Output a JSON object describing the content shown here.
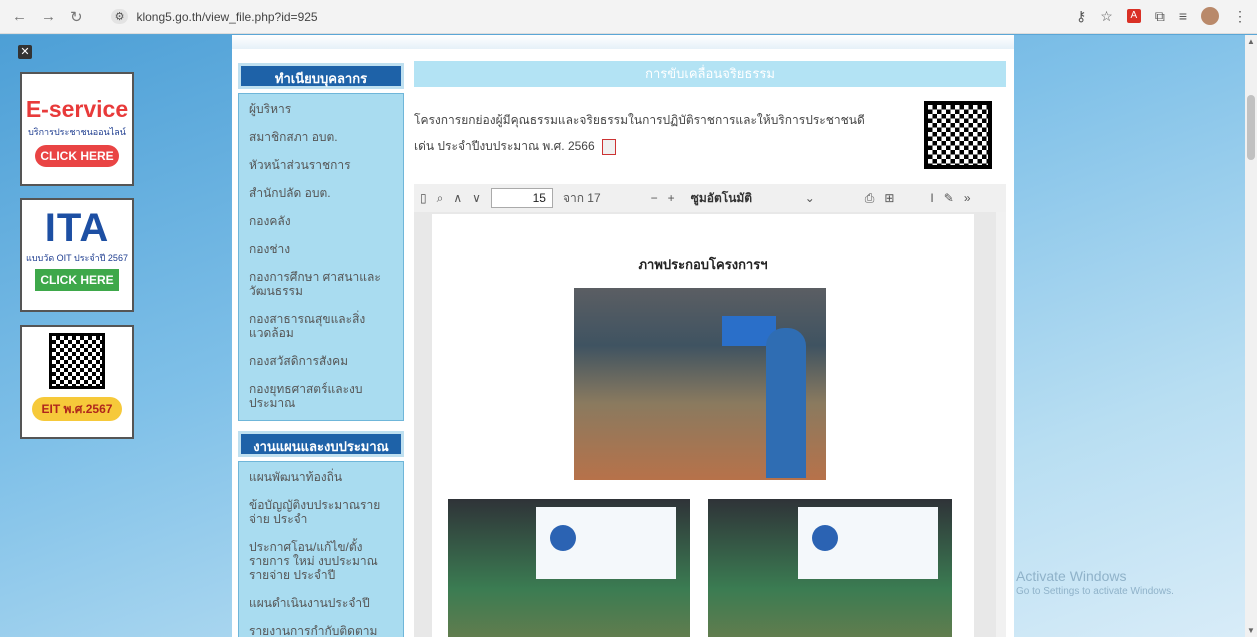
{
  "browser": {
    "url": "klong5.go.th/view_file.php?id=925"
  },
  "left_banners": {
    "eservice_title": "E-service",
    "eservice_sub": "บริการประชาชนออนไลน์",
    "eservice_btn": "CLICK HERE",
    "ita_title": "ITA",
    "ita_sub": "แบบวัด OIT ประจำปี 2567",
    "ita_btn": "CLICK HERE",
    "eit_btn": "EIT พ.ศ.2567"
  },
  "sidebar": {
    "section1_title": "ทำเนียบบุคลากร",
    "section1_items": [
      "ผู้บริหาร",
      "สมาชิกสภา อบต.",
      "หัวหน้าส่วนราชการ",
      "สำนักปลัด อบต.",
      "กองคลัง",
      "กองช่าง",
      "กองการศึกษา ศาสนาและ วัฒนธรรม",
      "กองสาธารณสุขและสิ่ง แวดล้อม",
      "กองสวัสดิการสังคม",
      "กองยุทธศาสตร์และงบ ประมาณ"
    ],
    "section2_title": "งานแผนและงบประมาณ",
    "section2_items": [
      "แผนพัฒนาท้องถิ่น",
      "ข้อบัญญัติงบประมาณรายจ่าย ประจำ",
      "ประกาศโอน/แก้ไข/ตั้งรายการ ใหม่ งบประมาณรายจ่าย ประจำปี",
      "แผนดำเนินงานประจำปี",
      "รายงานการกำกับติดตามการ"
    ]
  },
  "main": {
    "header": "การขับเคลื่อนจริยธรรม",
    "description": "โครงการยกย่องผู้มีคุณธรรมและจริยธรรมในการปฏิบัติราชการและให้บริการประชาชนดีเด่น ประจำปีงบประมาณ พ.ศ. 2566"
  },
  "pdf_viewer": {
    "page_current": "15",
    "page_total": "จาก 17",
    "zoom": "ซูมอัตโนมัติ",
    "page_heading": "ภาพประกอบโครงการฯ"
  },
  "watermark": {
    "line1": "Activate Windows",
    "line2": "Go to Settings to activate Windows."
  }
}
